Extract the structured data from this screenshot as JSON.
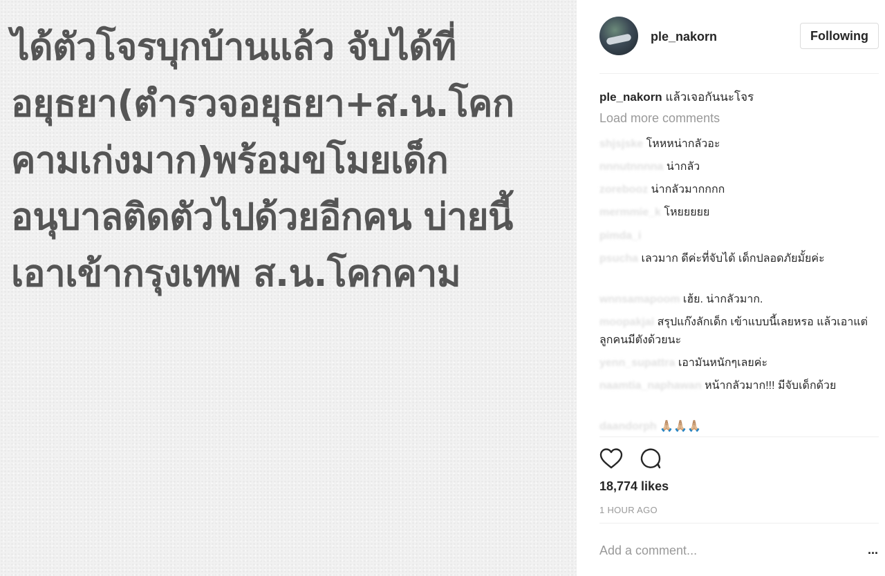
{
  "post": {
    "image_text": "ได้ตัวโจรบุกบ้านแล้ว จับได้ที่\nอยุธยา(ตำรวจอยุธยา+ส.น.โคก\nคามเก่งมาก)พร้อมขโมยเด็ก\nอนุบาลติดตัวไปด้วยอีกคน บ่ายนี้\nเอาเข้ากรุงเทพ ส.น.โคกคาม"
  },
  "header": {
    "username": "ple_nakorn",
    "follow_label": "Following"
  },
  "caption": {
    "username": "ple_nakorn",
    "text": "แล้วเจอกันนะโจร"
  },
  "load_more_label": "Load more comments",
  "comments": [
    {
      "user": "shjsjske",
      "text": "โหหหน่ากลัวอะ"
    },
    {
      "user": "nnnutnnnna",
      "text": "น่ากลัว"
    },
    {
      "user": "zorebooz",
      "text": "น่ากลัวมากกกก"
    },
    {
      "user": "mermmie_k",
      "text": "โหยยยยย"
    },
    {
      "user": "pimda_i",
      "text": ""
    },
    {
      "user": "psucha",
      "text": "เลวมาก ดีค่ะที่จับได้ เด็กปลอดภัยมั้ยค่ะ"
    },
    {
      "user": "wnnsamapoom",
      "text": "เฮ้ย. น่ากลัวมาก."
    },
    {
      "user": "moopakjai",
      "text": "สรุปแก๊งลักเด็ก เข้าแบบนี้เลยหรอ แล้วเอาแต่ลูกคนมีตังด้วยนะ"
    },
    {
      "user": "yenn_supattra",
      "text": "เอามันหนักๆเลยค่ะ"
    },
    {
      "user": "naamtia_naphawan",
      "text": "หน้ากลัวมาก!!! มีจับเด็กด้วย"
    },
    {
      "user": "daandorph",
      "text": "🙏🏼🙏🏼🙏🏼"
    }
  ],
  "likes_text": "18,774 likes",
  "time_ago": "1 HOUR AGO",
  "add_comment_placeholder": "Add a comment...",
  "more_options_label": "..."
}
